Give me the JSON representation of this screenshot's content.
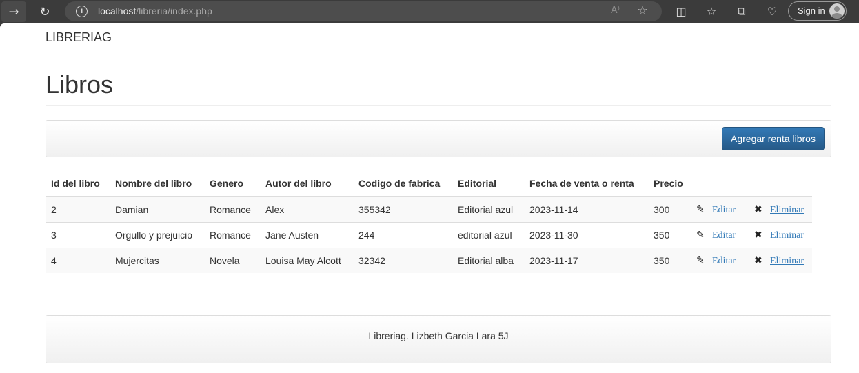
{
  "browser": {
    "url_host": "localhost",
    "url_path": "/libreria/index.php",
    "sign_in_label": "Sign in",
    "icons": {
      "back": "arrow-right-icon",
      "reload": "reload-icon",
      "info": "info-icon",
      "read_aloud": "read-aloud-icon",
      "favorite": "star-icon",
      "split": "split-screen-icon",
      "favorites": "favorites-icon",
      "collections": "collections-icon",
      "health": "browser-essentials-icon"
    }
  },
  "brand": "LIBRERIAG",
  "page_title": "Libros",
  "toolbar": {
    "add_label": "Agregar renta libros",
    "accent": "#337ab7"
  },
  "table": {
    "headers": [
      "Id del libro",
      "Nombre del libro",
      "Genero",
      "Autor del libro",
      "Codigo de fabrica",
      "Editorial",
      "Fecha de venta o renta",
      "Precio"
    ],
    "rows": [
      {
        "id": "2",
        "nombre": "Damian",
        "genero": "Romance",
        "autor": "Alex",
        "codigo": "355342",
        "editorial": "Editorial azul",
        "fecha": "2023-11-14",
        "precio": "300",
        "edit_label": "Editar",
        "delete_label": "Eliminar"
      },
      {
        "id": "3",
        "nombre": "Orgullo y prejuicio",
        "genero": "Romance",
        "autor": "Jane Austen",
        "codigo": "244",
        "editorial": "editorial azul",
        "fecha": "2023-11-30",
        "precio": "350",
        "edit_label": "Editar",
        "delete_label": "Eliminar"
      },
      {
        "id": "4",
        "nombre": "Mujercitas",
        "genero": "Novela",
        "autor": "Louisa May Alcott",
        "codigo": "32342",
        "editorial": "Editorial alba",
        "fecha": "2023-11-17",
        "precio": "350",
        "edit_label": "Editar",
        "delete_label": "Eliminar"
      }
    ]
  },
  "footer": "Libreriag. Lizbeth Garcia Lara 5J"
}
